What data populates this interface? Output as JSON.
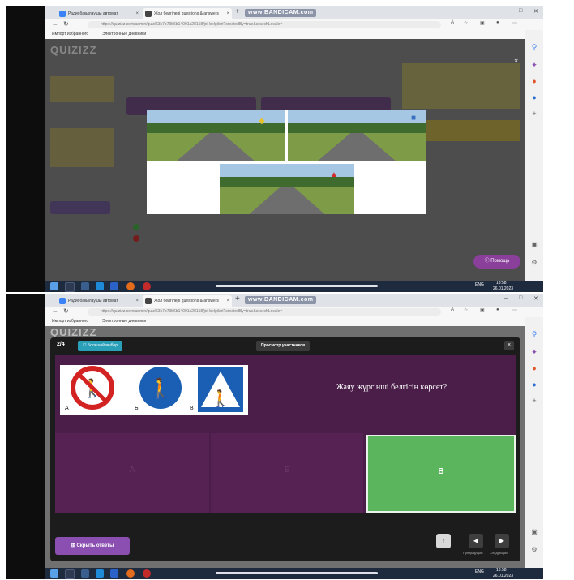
{
  "browser": {
    "tabs": [
      {
        "label": "Радиобакылаушы автомат",
        "color": "#3b82f6"
      },
      {
        "label": "Жол белгілері questions & answers",
        "color": "#444444"
      }
    ],
    "watermark": "www.BANDICAM.com",
    "url": "https://quizizz.com/admin/quiz/63c7b79b6b14001a28158/jol-belgileri?createdBy=true&searchLocale=",
    "bookmarks": [
      "Импорт избранного",
      "Электронные дневники"
    ]
  },
  "taskbar": {
    "lang": "ENG",
    "time": "13:58",
    "date": "26.01.2023"
  },
  "screen1": {
    "logo": "QUIZIZZ",
    "close": "×",
    "help_label": "Помощь"
  },
  "screen2": {
    "counter": "2/4",
    "mode_button": "Большой выбор",
    "preview_button": "Просмотр участников",
    "close": "×",
    "question": "Жаяу жүргінші белгісін көрсет?",
    "sign_letters": [
      "А",
      "Б",
      "В"
    ],
    "answers": [
      {
        "label": "А",
        "correct": false
      },
      {
        "label": "Б",
        "correct": false
      },
      {
        "label": "В",
        "correct": true
      }
    ],
    "show_answers": "Скрыть ответы",
    "prev_label": "Предыдущий",
    "next_label": "Следующий"
  },
  "colors": {
    "accent": "#2a9fb8",
    "quiz_bg": "#4a1e48",
    "correct": "#5bb55c",
    "purple_btn": "#8a4fb0"
  }
}
